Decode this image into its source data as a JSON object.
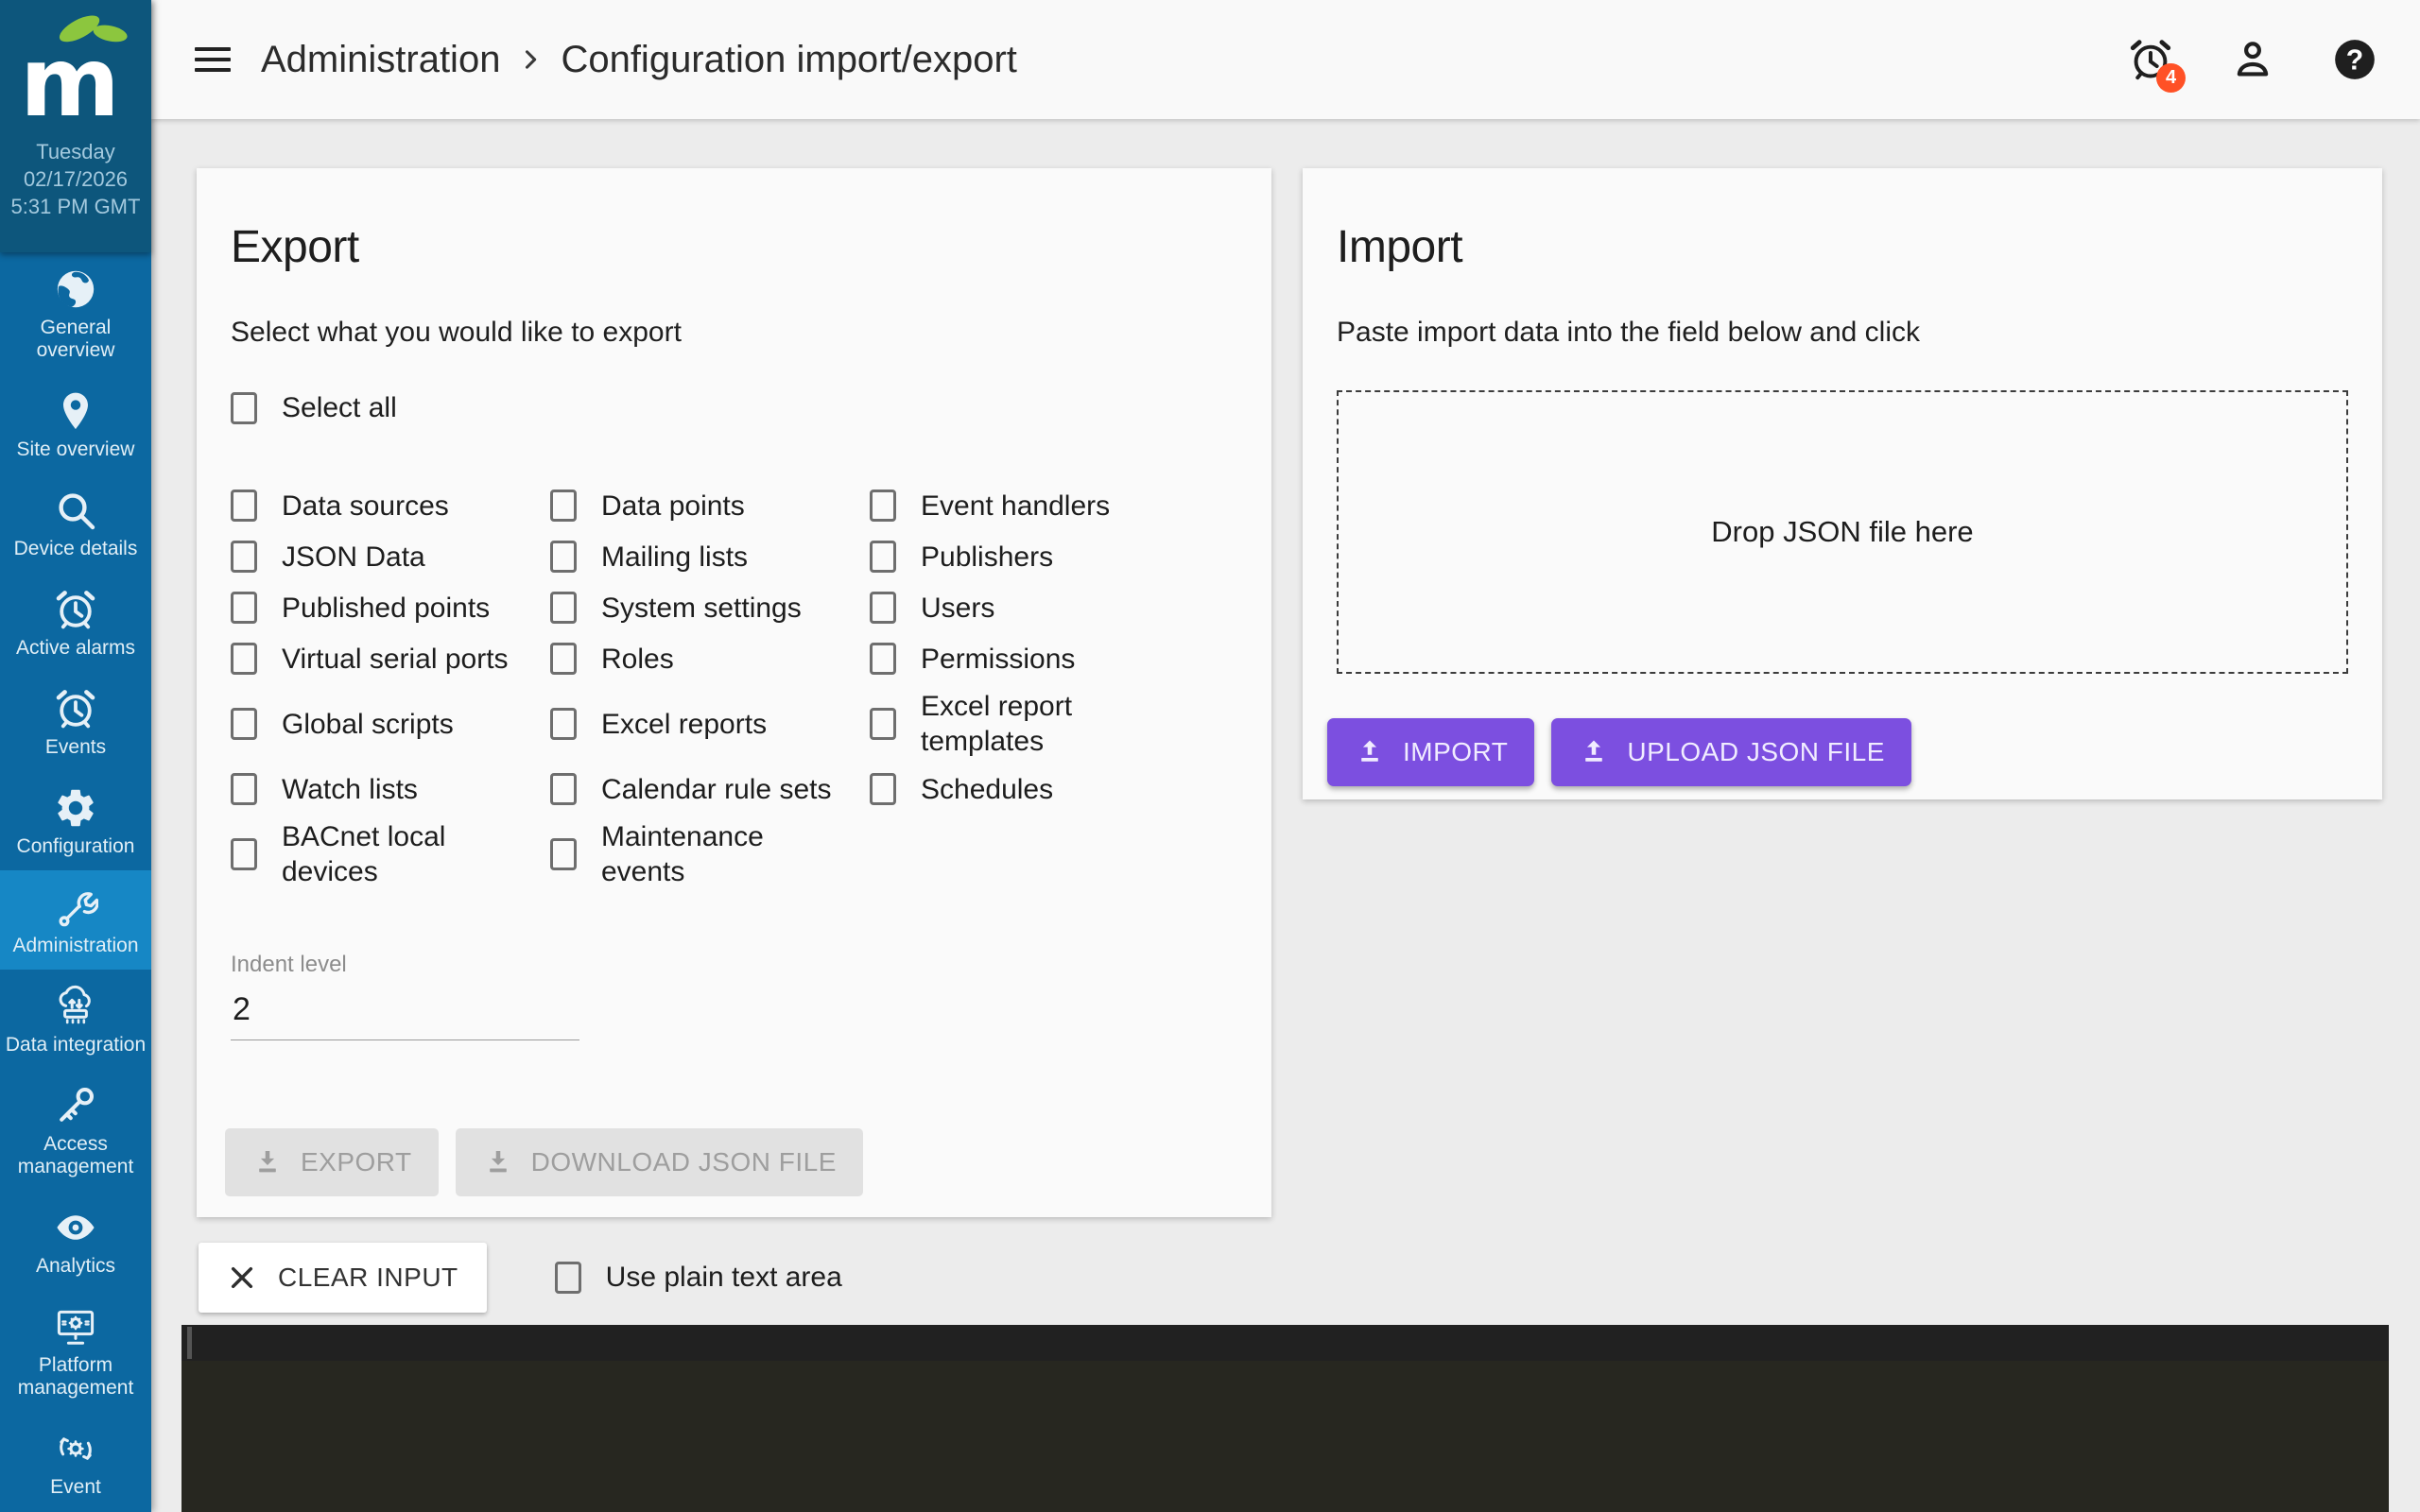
{
  "colors": {
    "sidebar_top_bg": "#0D567C",
    "sidebar_bg": "#0C68A1",
    "sidebar_active_bg": "#1687C5",
    "accent_purple": "#7C4FE0",
    "badge_orange": "#FF5126",
    "editor_bg": "#272720",
    "editor_strip_bg": "#212121",
    "leaf_green": "#8CC63E"
  },
  "sidebar": {
    "datetime": {
      "day": "Tuesday",
      "date": "02/17/2026",
      "time": "5:31 PM GMT"
    },
    "items": [
      {
        "label": "General overview",
        "icon": "globe-icon",
        "active": false
      },
      {
        "label": "Site overview",
        "icon": "location-pin-icon",
        "active": false
      },
      {
        "label": "Device details",
        "icon": "search-icon",
        "active": false
      },
      {
        "label": "Active alarms",
        "icon": "alarm-clock-icon",
        "active": false
      },
      {
        "label": "Events",
        "icon": "alarm-clock-icon",
        "active": false
      },
      {
        "label": "Configuration",
        "icon": "gear-icon",
        "active": false
      },
      {
        "label": "Administration",
        "icon": "wrench-icon",
        "active": true
      },
      {
        "label": "Data integration",
        "icon": "cloud-device-icon",
        "active": false
      },
      {
        "label": "Access management",
        "icon": "key-icon",
        "active": false
      },
      {
        "label": "Analytics",
        "icon": "eye-icon",
        "active": false
      },
      {
        "label": "Platform management",
        "icon": "monitor-gear-icon",
        "active": false
      },
      {
        "label": "Event",
        "icon": "gear-arrows-icon",
        "active": false
      }
    ]
  },
  "header": {
    "breadcrumb_parent": "Administration",
    "breadcrumb_current": "Configuration import/export",
    "alarm_count": "4"
  },
  "export_card": {
    "title": "Export",
    "subtitle": "Select what you would like to export",
    "select_all_label": "Select all",
    "rows": [
      [
        "Data sources",
        "Data points",
        "Event handlers"
      ],
      [
        "JSON Data",
        "Mailing lists",
        "Publishers"
      ],
      [
        "Published points",
        "System settings",
        "Users"
      ],
      [
        "Virtual serial ports",
        "Roles",
        "Permissions"
      ],
      [
        "Global scripts",
        "Excel reports",
        "Excel report\ntemplates"
      ],
      [
        "Watch lists",
        "Calendar rule sets",
        "Schedules"
      ],
      [
        "BACnet local\ndevices",
        "Maintenance\nevents",
        ""
      ]
    ],
    "indent_label": "Indent level",
    "indent_value": "2",
    "export_button_label": "EXPORT",
    "download_button_label": "DOWNLOAD JSON FILE"
  },
  "import_card": {
    "title": "Import",
    "instruction": "Paste import data into the field below and click",
    "dropzone_text": "Drop JSON file here",
    "import_button_label": "IMPORT",
    "upload_button_label": "UPLOAD JSON FILE"
  },
  "footer": {
    "clear_button_label": "CLEAR INPUT",
    "plain_text_label": "Use plain text area"
  }
}
